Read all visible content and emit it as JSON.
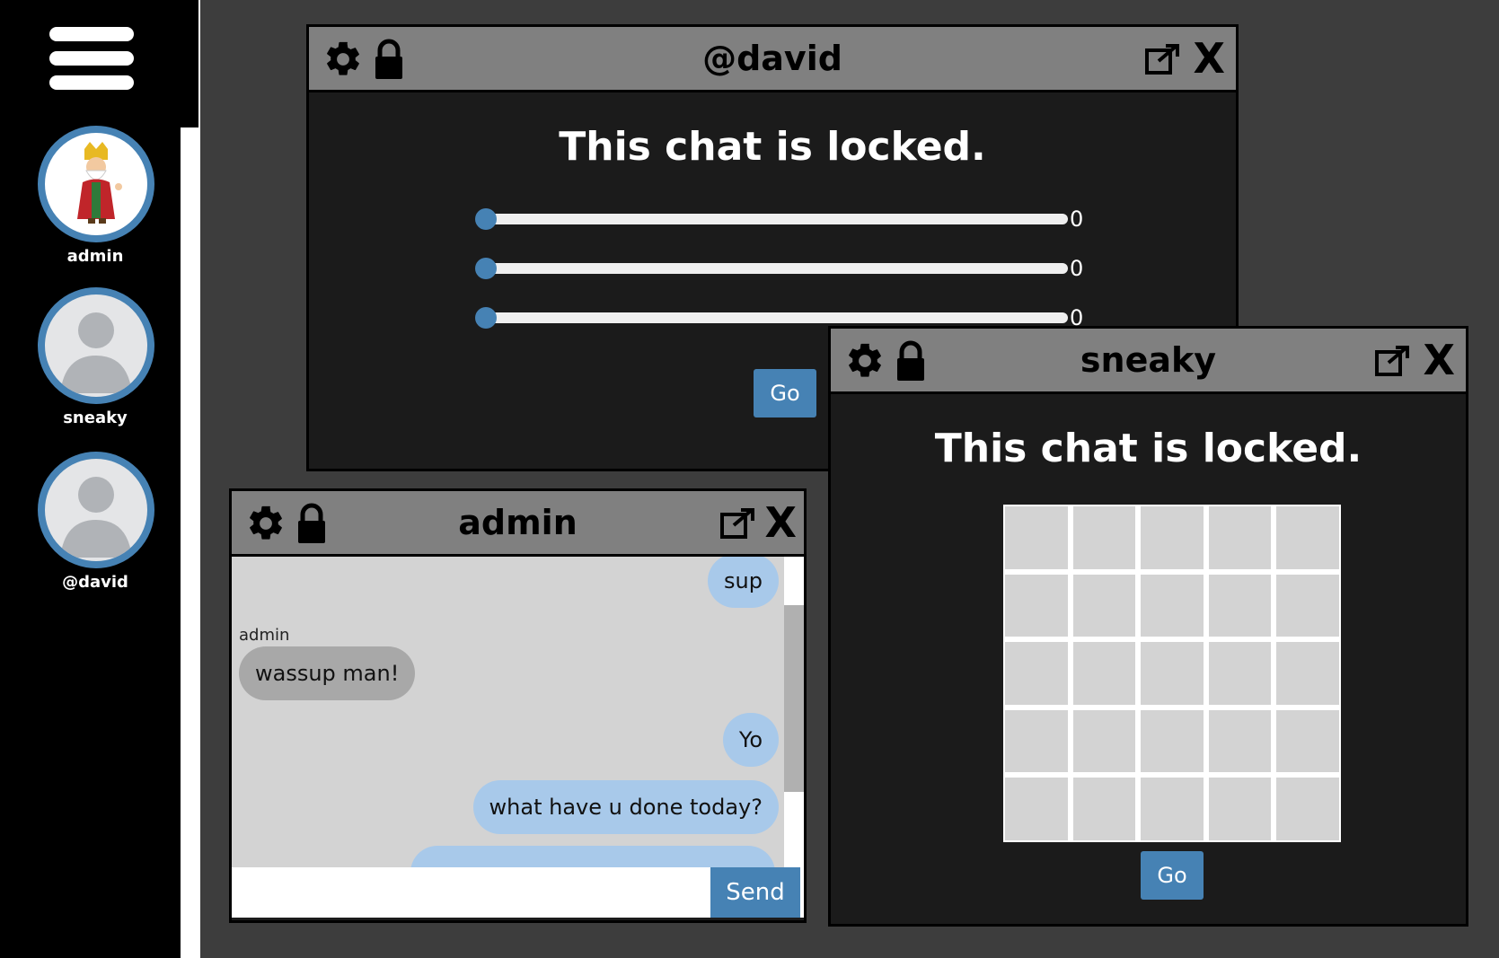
{
  "sidebar": {
    "contacts": [
      {
        "name": "admin"
      },
      {
        "name": "sneaky"
      },
      {
        "name": "@david"
      }
    ]
  },
  "windows": {
    "david": {
      "title": "@david",
      "locked_text": "This chat is locked.",
      "sliders": [
        {
          "value": "0",
          "fraction": 0
        },
        {
          "value": "0",
          "fraction": 0
        },
        {
          "value": "0",
          "fraction": 0
        }
      ],
      "go_label": "Go"
    },
    "sneaky": {
      "title": "sneaky",
      "locked_text": "This chat is locked.",
      "go_label": "Go"
    },
    "admin": {
      "title": "admin",
      "messages": [
        {
          "text": "sup",
          "from": "me"
        },
        {
          "sender": "admin",
          "text": "wassup man!",
          "from": "them"
        },
        {
          "text": "Yo",
          "from": "me"
        },
        {
          "text": "what have u done today?",
          "from": "me"
        }
      ],
      "input_placeholder": "",
      "send_label": "Send"
    }
  },
  "colors": {
    "accent": "#4682b4",
    "my_bubble": "#a8c9ea",
    "their_bubble": "#a8a8a8",
    "window_bg": "#1b1b1b",
    "header_bg": "#808080",
    "desktop_bg": "#3d3d3d"
  },
  "icons": [
    "menu-icon",
    "gear-icon",
    "lock-icon",
    "external-link-icon",
    "close-icon"
  ]
}
